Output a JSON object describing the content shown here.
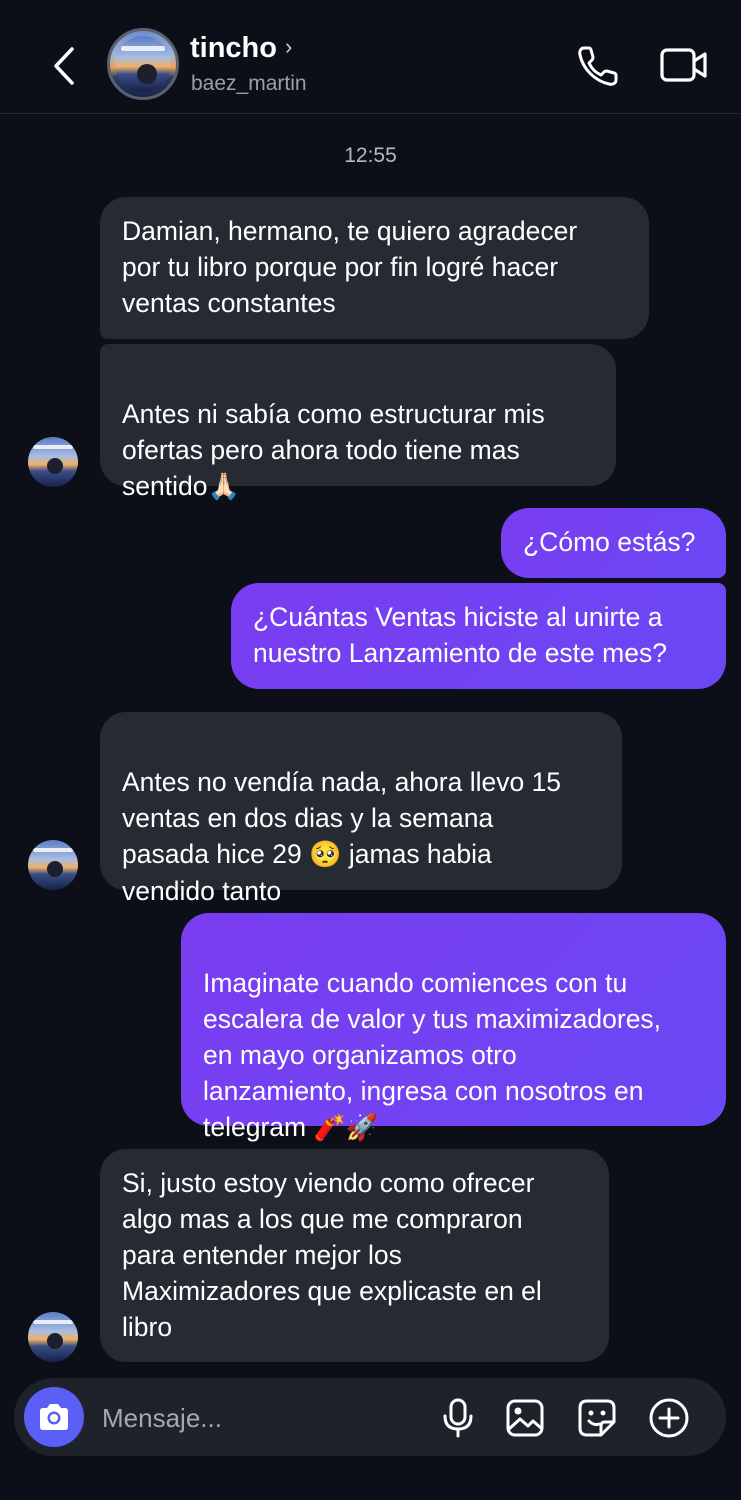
{
  "header": {
    "name": "tincho",
    "name_chevron": "›",
    "username": "baez_martin"
  },
  "timestamp": "12:55",
  "messages": [
    {
      "side": "in",
      "text": "Damian, hermano, te quiero agradecer\npor tu libro porque por fin logré hacer\nventas constantes"
    },
    {
      "side": "in",
      "text": "Antes ni sabía como estructurar mis\nofertas pero ahora todo tiene mas\nsentido",
      "emoji": "🙏🏻"
    },
    {
      "side": "out",
      "text": "¿Cómo estás?"
    },
    {
      "side": "out",
      "text": "¿Cuántas Ventas hiciste al unirte a\nnuestro Lanzamiento de este mes?"
    },
    {
      "side": "in",
      "text_before": "Antes no vendía nada, ahora llevo 15\nventas en dos dias y la semana\npasada hice 29",
      "emoji": "🥺",
      "text_after": " jamas habia\nvendido tanto"
    },
    {
      "side": "out",
      "text": "Imaginate cuando comiences con tu\nescalera de valor y tus maximizadores,\nen mayo organizamos otro\nlanzamiento, ingresa con nosotros en\ntelegram",
      "emoji": "🧨🚀"
    },
    {
      "side": "in",
      "text": "Si, justo estoy viendo como ofrecer\nalgo mas a los que me compraron\npara entender mejor los\nMaximizadores que explicaste en el\nlibro"
    }
  ],
  "composer": {
    "placeholder": "Mensaje..."
  },
  "icons": [
    "back-chevron-icon",
    "phone-icon",
    "video-camera-icon",
    "camera-icon",
    "microphone-icon",
    "image-icon",
    "sticker-icon",
    "plus-circle-icon"
  ],
  "colors": {
    "background": "#0c0f18",
    "incoming_bubble": "#262a33",
    "outgoing_bubble": "#7a3cf0",
    "camera_button": "#5b5ff5"
  }
}
